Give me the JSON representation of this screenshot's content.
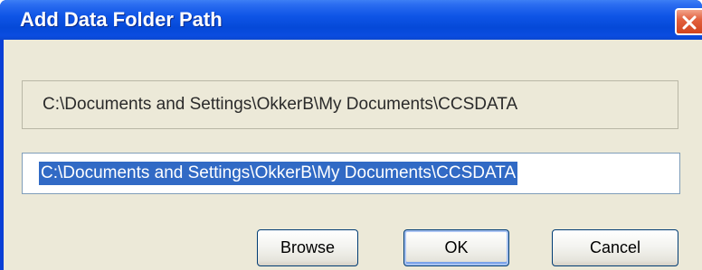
{
  "window": {
    "title": "Add Data Folder Path",
    "close_icon": "close-icon"
  },
  "dialog": {
    "current_path_label": "C:\\Documents and Settings\\OkkerB\\My Documents\\CCSDATA",
    "path_input_value": "C:\\Documents and Settings\\OkkerB\\My Documents\\CCSDATA"
  },
  "buttons": {
    "browse_label": "Browse",
    "ok_label": "OK",
    "cancel_label": "Cancel"
  },
  "colors": {
    "titlebar": "#0549d8",
    "selection": "#316ac5",
    "dialog_bg": "#ece9d8",
    "close_button": "#e2623f"
  }
}
